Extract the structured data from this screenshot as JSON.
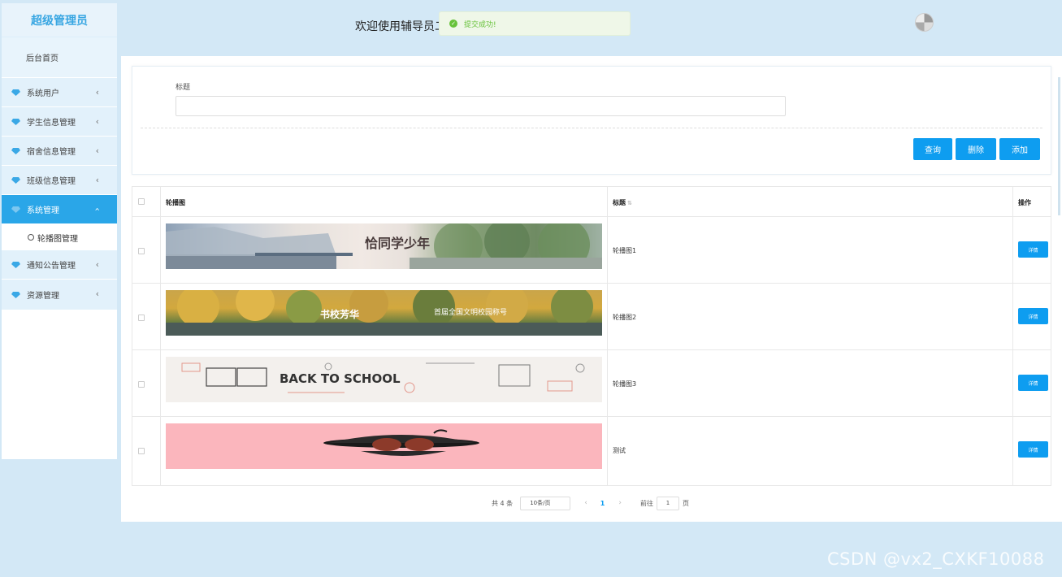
{
  "sidebar": {
    "brand": "超级管理员",
    "home": "后台首页",
    "items": [
      {
        "label": "系统用户"
      },
      {
        "label": "学生信息管理"
      },
      {
        "label": "宿舍信息管理"
      },
      {
        "label": "班级信息管理"
      },
      {
        "label": "系统管理"
      },
      {
        "label": "通知公告管理"
      },
      {
        "label": "资源管理"
      }
    ],
    "sub_item": "轮播图管理"
  },
  "header": {
    "welcome": "欢迎使用辅导员二",
    "toast": "提交成功!"
  },
  "search": {
    "label": "标题",
    "query_btn": "查询",
    "delete_btn": "删除",
    "add_btn": "添加"
  },
  "table": {
    "headers": {
      "image": "轮播图",
      "title": "标题",
      "action": "操作"
    },
    "rows": [
      {
        "title": "轮播图1",
        "detail": "详情"
      },
      {
        "title": "轮播图2",
        "detail": "详情"
      },
      {
        "title": "轮播图3",
        "detail": "详情"
      },
      {
        "title": "测试",
        "detail": "详情"
      }
    ],
    "banner_text": {
      "row1": "恰同学少年",
      "row2": "书校芳华",
      "row2b": "首届全国文明校园称号",
      "row3": "BACK TO SCHOOL"
    }
  },
  "pager": {
    "total": "共 4 条",
    "page_size": "10条/页",
    "current": "1",
    "goto_label": "前往",
    "goto_value": "1",
    "goto_unit": "页"
  },
  "watermark": "CSDN @vx2_CXKF10088"
}
